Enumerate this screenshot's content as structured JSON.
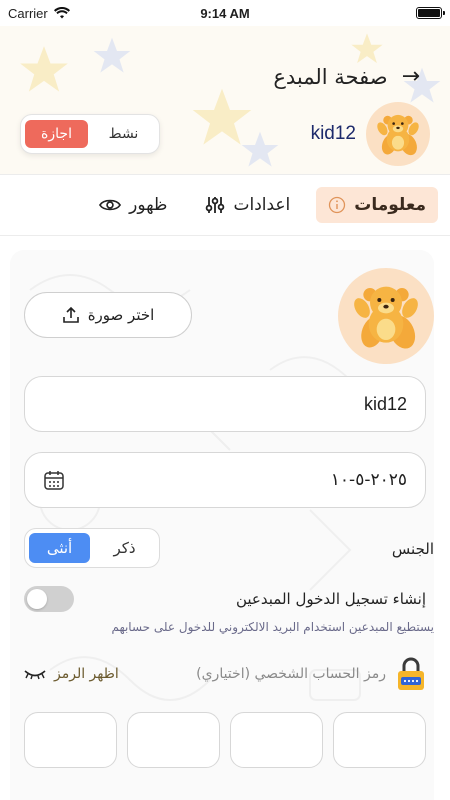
{
  "status_bar": {
    "carrier": "Carrier",
    "time": "9:14 AM"
  },
  "header": {
    "title": "صفحة المبدع",
    "back_icon": "arrow-right-icon",
    "creator_name": "kid12",
    "status_active_label": "نشط",
    "status_vacation_label": "اجازة",
    "status_selected": "vacation"
  },
  "tabs": [
    {
      "label": "ظهور",
      "icon": "eye-icon",
      "active": false
    },
    {
      "label": "اعدادات",
      "icon": "sliders-icon",
      "active": false
    },
    {
      "label": "معلومات",
      "icon": "info-icon",
      "active": true
    }
  ],
  "form": {
    "choose_photo_label": "اختر صورة",
    "name_value": "kid12",
    "date_value": "٢٠٢٥-٥-١٠",
    "gender_label": "الجنس",
    "gender_male": "ذكر",
    "gender_female": "أنثى",
    "gender_selected": "female",
    "login_title": "إنشاء تسجيل الدخول المبدعين",
    "login_enabled": false,
    "login_desc": "يستطيع المبدعين استخدام البريد الالكتروني للدخول على حسابهم",
    "pin_label": "رمز الحساب الشخصي (اختياري)",
    "show_pin_label": "اظهر الرمز",
    "pin_count": 4
  },
  "colors": {
    "accent_vacation": "#ee6a5c",
    "accent_female": "#4d8df3",
    "active_tab_bg": "#fde6d6",
    "avatar_bg": "#fbe0c4"
  }
}
